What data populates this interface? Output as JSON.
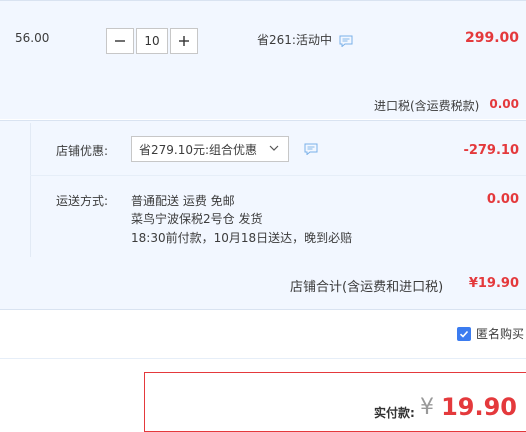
{
  "item": {
    "unit_price": "56.00",
    "quantity": "10",
    "saving_text": "省261:活动中",
    "total": "299.00",
    "tax_label": "进口税(含运费税款)",
    "tax_value": "0.00"
  },
  "shop": {
    "discount_label": "店铺优惠:",
    "discount_selected": "省279.10元:组合优惠",
    "discount_value": "-279.10",
    "shipping_label": "运送方式:",
    "shipping_line1": "普通配送  运费  免邮",
    "shipping_line2": "菜鸟宁波保税2号仓   发货",
    "shipping_line3": "18:30前付款，10月18日送达，晚到必赔",
    "shipping_value": "0.00",
    "subtotal_label": "店铺合计(含运费和进口税)",
    "subtotal_value": "¥19.90"
  },
  "anonymous": {
    "label": "匿名购买",
    "checked": true
  },
  "payment": {
    "label": "实付款:",
    "currency": "¥",
    "value": "19.90"
  },
  "colors": {
    "accent_red": "#e4393c",
    "panel_blue": "#f2f7ff",
    "checkbox_blue": "#3b7cf0"
  },
  "icons": {
    "chat": "chat-bubble-icon",
    "dropdown": "chevron-down-icon",
    "minus": "minus-icon",
    "plus": "plus-icon",
    "check": "check-icon"
  }
}
